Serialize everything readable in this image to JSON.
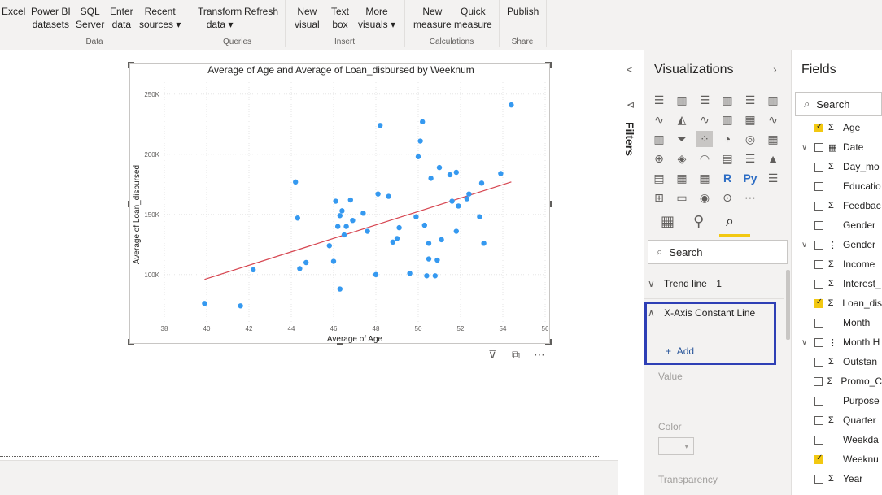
{
  "ribbon": {
    "buttons": [
      {
        "label": "Excel"
      },
      {
        "label": "Power BI\ndatasets"
      },
      {
        "label": "SQL\nServer"
      },
      {
        "label": "Enter\ndata"
      },
      {
        "label": "Recent\nsources ▾"
      },
      {
        "label": "Transform\ndata ▾"
      },
      {
        "label": "Refresh"
      },
      {
        "label": "New\nvisual"
      },
      {
        "label": "Text\nbox"
      },
      {
        "label": "More\nvisuals ▾"
      },
      {
        "label": "New\nmeasure"
      },
      {
        "label": "Quick\nmeasure"
      },
      {
        "label": "Publish"
      }
    ],
    "groups": {
      "data": "Data",
      "queries": "Queries",
      "insert": "Insert",
      "calculations": "Calculations",
      "share": "Share"
    }
  },
  "chart_data": {
    "type": "scatter",
    "title": "Average of Age and Average of Loan_disbursed by Weeknum",
    "xlabel": "Average of Age",
    "ylabel": "Average of Loan_disbursed",
    "xlim": [
      38,
      56
    ],
    "ylim": [
      60000,
      260000
    ],
    "x_ticks": [
      "38",
      "40",
      "42",
      "44",
      "46",
      "48",
      "50",
      "52",
      "54",
      "56"
    ],
    "y_ticks": [
      "100K",
      "150K",
      "200K",
      "250K"
    ],
    "grid": true,
    "point_color": "#3599f0",
    "trend_color": "#d64550",
    "trend_line": [
      [
        39.9,
        96000
      ],
      [
        54.4,
        177000
      ]
    ],
    "points": [
      [
        39.9,
        76000
      ],
      [
        41.6,
        74000
      ],
      [
        42.2,
        104000
      ],
      [
        44.2,
        177000
      ],
      [
        44.3,
        147000
      ],
      [
        44.4,
        105000
      ],
      [
        44.7,
        110000
      ],
      [
        45.8,
        124000
      ],
      [
        46.0,
        111000
      ],
      [
        46.1,
        161000
      ],
      [
        46.2,
        140000
      ],
      [
        46.3,
        88000
      ],
      [
        46.3,
        149000
      ],
      [
        46.4,
        153000
      ],
      [
        46.5,
        133000
      ],
      [
        46.6,
        140000
      ],
      [
        46.8,
        162000
      ],
      [
        46.9,
        145000
      ],
      [
        47.4,
        151000
      ],
      [
        47.6,
        136000
      ],
      [
        48.0,
        100000
      ],
      [
        48.1,
        167000
      ],
      [
        48.2,
        224000
      ],
      [
        48.6,
        165000
      ],
      [
        48.8,
        127000
      ],
      [
        49.0,
        130000
      ],
      [
        49.1,
        139000
      ],
      [
        49.6,
        101000
      ],
      [
        49.9,
        148000
      ],
      [
        50.0,
        198000
      ],
      [
        50.1,
        211000
      ],
      [
        50.2,
        227000
      ],
      [
        50.3,
        141000
      ],
      [
        50.4,
        99000
      ],
      [
        50.5,
        126000
      ],
      [
        50.5,
        113000
      ],
      [
        50.6,
        180000
      ],
      [
        50.8,
        99000
      ],
      [
        50.9,
        112000
      ],
      [
        51.0,
        189000
      ],
      [
        51.1,
        129000
      ],
      [
        51.5,
        183000
      ],
      [
        51.6,
        161000
      ],
      [
        51.8,
        185000
      ],
      [
        51.8,
        136000
      ],
      [
        51.9,
        157000
      ],
      [
        52.3,
        163000
      ],
      [
        52.4,
        167000
      ],
      [
        52.9,
        148000
      ],
      [
        53.0,
        176000
      ],
      [
        53.1,
        126000
      ],
      [
        53.9,
        184000
      ],
      [
        54.4,
        241000
      ]
    ]
  },
  "filters_label": "Filters",
  "viz": {
    "title": "Visualizations",
    "search_placeholder": "Search",
    "trend_line_label": "Trend line",
    "trend_line_count": "1",
    "xaxis_constant_label": "X-Axis Constant Line",
    "add_label": "Add",
    "value_label": "Value",
    "color_label": "Color",
    "transparency_label": "Transparency",
    "accent_color": "#f2c811"
  },
  "fields": {
    "title": "Fields",
    "search_placeholder": "Search",
    "items": [
      {
        "chevron": "",
        "checked": true,
        "icon": "Σ",
        "label": "Age"
      },
      {
        "chevron": "∨",
        "checked": false,
        "icon": "▦",
        "label": "Date"
      },
      {
        "chevron": "",
        "checked": false,
        "icon": "Σ",
        "label": "Day_mo"
      },
      {
        "chevron": "",
        "checked": false,
        "icon": "",
        "label": "Educatio"
      },
      {
        "chevron": "",
        "checked": false,
        "icon": "Σ",
        "label": "Feedbac"
      },
      {
        "chevron": "",
        "checked": false,
        "icon": "",
        "label": "Gender"
      },
      {
        "chevron": "∨",
        "checked": false,
        "icon": "⋮",
        "label": "Gender"
      },
      {
        "chevron": "",
        "checked": false,
        "icon": "Σ",
        "label": "Income"
      },
      {
        "chevron": "",
        "checked": false,
        "icon": "Σ",
        "label": "Interest_"
      },
      {
        "chevron": "",
        "checked": true,
        "icon": "Σ",
        "label": "Loan_dis"
      },
      {
        "chevron": "",
        "checked": false,
        "icon": "",
        "label": "Month"
      },
      {
        "chevron": "∨",
        "checked": false,
        "icon": "⋮",
        "label": "Month H"
      },
      {
        "chevron": "",
        "checked": false,
        "icon": "Σ",
        "label": "Outstan"
      },
      {
        "chevron": "",
        "checked": false,
        "icon": "Σ",
        "label": "Promo_C"
      },
      {
        "chevron": "",
        "checked": false,
        "icon": "",
        "label": "Purpose"
      },
      {
        "chevron": "",
        "checked": false,
        "icon": "Σ",
        "label": "Quarter"
      },
      {
        "chevron": "",
        "checked": false,
        "icon": "",
        "label": "Weekda"
      },
      {
        "chevron": "",
        "checked": true,
        "icon": "",
        "label": "Weeknu"
      },
      {
        "chevron": "",
        "checked": false,
        "icon": "Σ",
        "label": "Year"
      }
    ]
  }
}
